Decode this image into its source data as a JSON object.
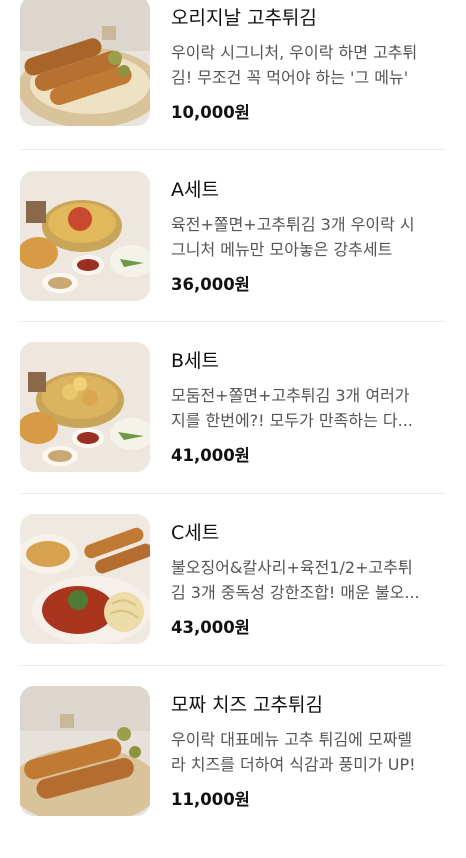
{
  "menu": {
    "items": [
      {
        "name": "오리지날 고추튀김",
        "desc_line1": "우이락 시그니처, 우이락 하면 고추튀",
        "desc_line2": "김! 무조건 꼭 먹어야 하는 '그 메뉴'",
        "price": "10,000원",
        "image_icon": "fried-pepper-photo"
      },
      {
        "name": "A세트",
        "desc_line1": "육전+쫄면+고추튀김 3개 우이락 시",
        "desc_line2": "그니처 메뉴만 모아놓은 강추세트",
        "price": "36,000원",
        "image_icon": "set-platter-photo"
      },
      {
        "name": "B세트",
        "desc_line1": "모둠전+쫄면+고추튀김 3개 여러가",
        "desc_line2": "지를 한번에?! 모두가 만족하는 다...",
        "price": "41,000원",
        "image_icon": "set-platter-photo"
      },
      {
        "name": "C세트",
        "desc_line1": "불오징어&칼사리+육전1/2+고추튀",
        "desc_line2": "김 3개 중독성 강한조합! 매운 불오...",
        "price": "43,000원",
        "image_icon": "squid-noodle-photo"
      },
      {
        "name": "모짜 치즈 고추튀김",
        "desc_line1": "우이락 대표메뉴 고추 튀김에 모짜렐",
        "desc_line2": "라 치즈를 더하여 식감과 풍미가 UP!",
        "price": "11,000원",
        "image_icon": "cheese-fried-pepper-photo"
      }
    ]
  }
}
